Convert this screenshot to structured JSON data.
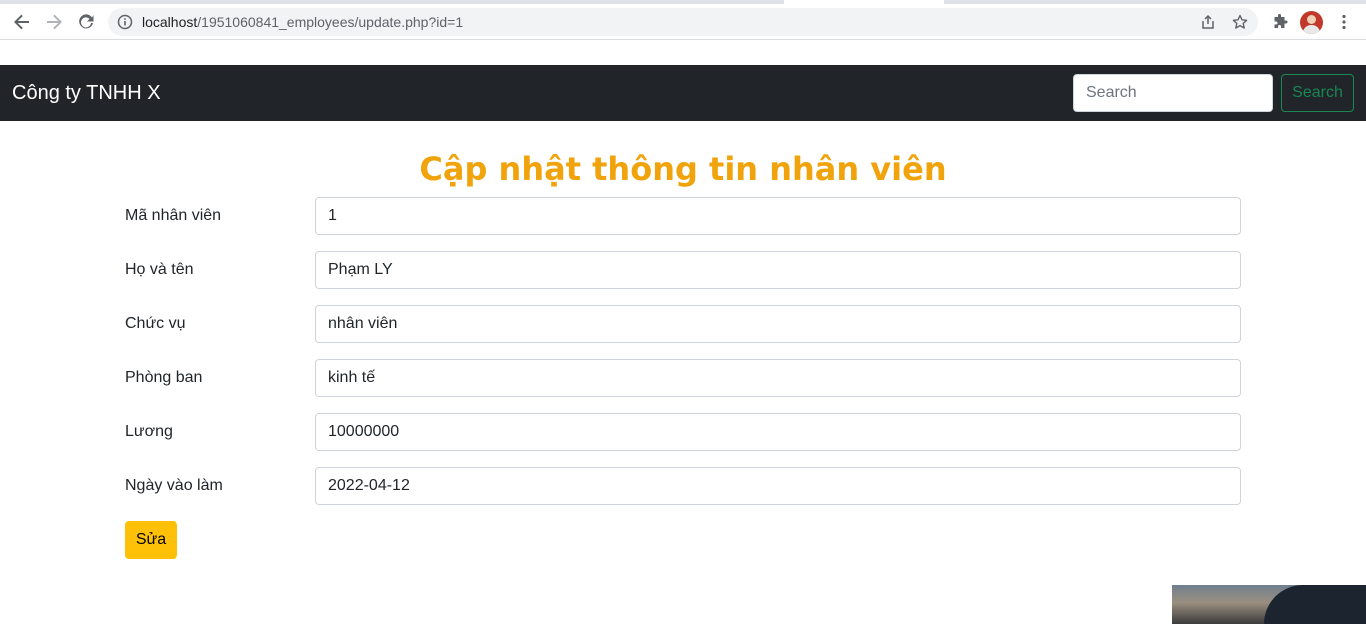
{
  "browser": {
    "url_host": "localhost",
    "url_path": "/1951060841_employees/update.php?id=1"
  },
  "navbar": {
    "brand": "Công ty TNHH X",
    "search_placeholder": "Search",
    "search_button": "Search"
  },
  "form": {
    "title": "Cập nhật thông tin nhân viên",
    "fields": [
      {
        "label": "Mã nhân viên",
        "value": "1"
      },
      {
        "label": "Họ và tên",
        "value": "Phạm LY"
      },
      {
        "label": "Chức vụ",
        "value": "nhân viên"
      },
      {
        "label": "Phòng ban",
        "value": "kinh tế"
      },
      {
        "label": "Lương",
        "value": "10000000"
      },
      {
        "label": "Ngày vào làm",
        "value": "2022-04-12"
      }
    ],
    "submit_label": "Sửa"
  },
  "colors": {
    "navbar_bg": "#212529",
    "title": "#f0a30a",
    "submit_bg": "#ffc107",
    "search_outline": "#198754"
  },
  "icons": [
    "back-arrow-icon",
    "forward-arrow-icon",
    "reload-icon",
    "info-icon",
    "share-icon",
    "star-icon",
    "extensions-icon",
    "profile-avatar",
    "menu-dots-icon"
  ]
}
